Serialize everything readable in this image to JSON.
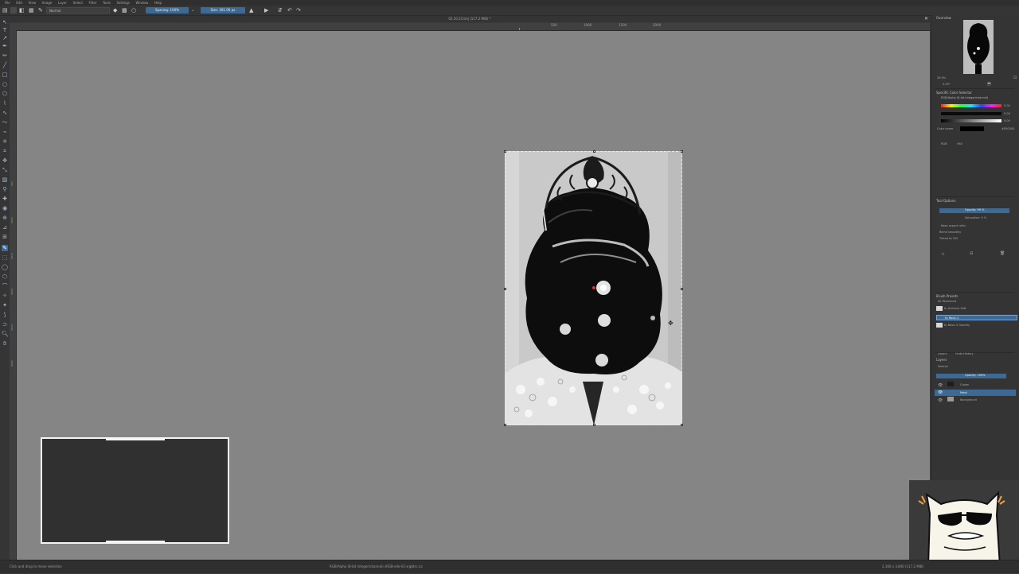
{
  "menu": [
    "File",
    "Edit",
    "View",
    "Image",
    "Layer",
    "Select",
    "Filter",
    "Tools",
    "Settings",
    "Window",
    "Help"
  ],
  "toolbar": {
    "blend_mode": "Normal",
    "spacing": "Spacing: 100%",
    "size": "Size: 301.00 px"
  },
  "document": {
    "title": "02.10 23.tmj (117.2 MiB) *"
  },
  "ruler": {
    "h_labels": [
      "500",
      "1000",
      "1500",
      "2000"
    ],
    "v_labels": [
      "500",
      "1000",
      "1500",
      "2000",
      "2500",
      "3000"
    ]
  },
  "dock": {
    "overview_title": "Overview",
    "zoom": "26.9%",
    "rotation": "0.00°",
    "color_selector_title": "Specific Color Selector",
    "color_profile": "RGB/Alpha (8-bit integer/channel)",
    "color_values": [
      "0.00",
      "0.00",
      "0.00"
    ],
    "color_name_label": "Color name",
    "color_hex": "#000000",
    "color_models": [
      "RGB",
      "HSV"
    ],
    "tool_options_title": "Tool Options",
    "opacity": "Opacity: 99 %",
    "saturation": "Saturation: 0 %",
    "keep_aspect": "Keep aspect ratio",
    "blend_label": "Blend smoothly",
    "mix_mode": "Tinted to 100",
    "brush_presets_title": "Brush Presets",
    "brush_filter": "All Resources",
    "presets": [
      "b) Airbrush Soft",
      "b) Basic-2",
      "b) Basic-5 Opacity"
    ],
    "layers_tabs": [
      "Layers",
      "Undo History"
    ],
    "layers_title": "Layers",
    "layer_blend": "Normal",
    "layer_opacity": "Opacity: 100%",
    "layers": [
      "Crown",
      "Mask",
      "Background"
    ]
  },
  "status": {
    "left": "Click and drag to move selection",
    "center": "RGB/Alpha (8-bit integer/channel)  sRGB-elle-V2-srgbtrc.icc",
    "right": "2,160 x 3,840 (117.2 MiB)"
  },
  "colors": {
    "accent": "#3d6a95",
    "canvas_bg": "#858585",
    "panel_bg": "#343434"
  }
}
